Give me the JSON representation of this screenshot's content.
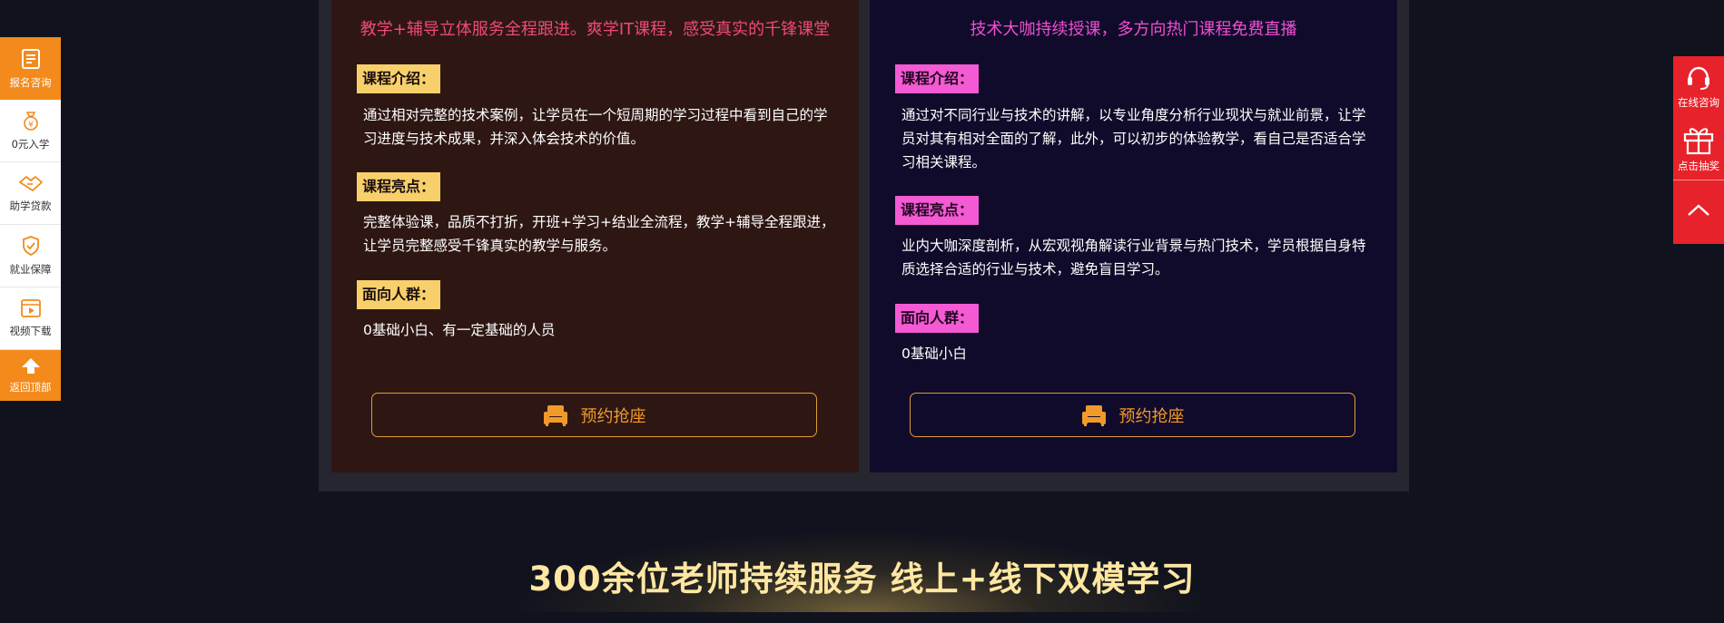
{
  "left_card": {
    "subtitle": "教学+辅导立体服务全程跟进。爽学IT课程，感受真实的千锋课堂",
    "intro_label": "课程介绍：",
    "intro_text": "通过相对完整的技术案例，让学员在一个短周期的学习过程中看到自己的学习进度与技术成果，并深入体会技术的价值。",
    "highlight_label": "课程亮点：",
    "highlight_text": "完整体验课，品质不打折，开班+学习+结业全流程，教学+辅导全程跟进，让学员完整感受千锋真实的教学与服务。",
    "audience_label": "面向人群：",
    "audience_text": "0基础小白、有一定基础的人员",
    "button_label": "预约抢座"
  },
  "right_card": {
    "subtitle": "技术大咖持续授课，多方向热门课程免费直播",
    "intro_label": "课程介绍：",
    "intro_text": "通过对不同行业与技术的讲解，以专业角度分析行业现状与就业前景，让学员对其有相对全面的了解，此外，可以初步的体验教学，看自己是否适合学习相关课程。",
    "highlight_label": "课程亮点：",
    "highlight_text": "业内大咖深度剖析，从宏观视角解读行业背景与热门技术，学员根据自身特质选择合适的行业与技术，避免盲目学习。",
    "audience_label": "面向人群：",
    "audience_text": "0基础小白",
    "button_label": "预约抢座"
  },
  "headline": "300余位老师持续服务 线上+线下双模学习",
  "left_bar": {
    "items": [
      {
        "label": "报名咨询",
        "icon": "register-icon"
      },
      {
        "label": "0元入学",
        "icon": "money-bag-icon"
      },
      {
        "label": "助学贷款",
        "icon": "handshake-icon"
      },
      {
        "label": "就业保障",
        "icon": "shield-check-icon"
      },
      {
        "label": "视频下载",
        "icon": "video-icon"
      },
      {
        "label": "返回顶部",
        "icon": "arrow-up-icon"
      }
    ]
  },
  "right_bar": {
    "items": [
      {
        "label": "在线咨询",
        "icon": "headset-icon"
      },
      {
        "label": "点击抽奖",
        "icon": "gift-icon"
      }
    ],
    "top_icon": "chevron-up-icon"
  },
  "colors": {
    "left_accent": "#ef4a78",
    "right_accent": "#ef4fd1",
    "left_tag": "#f7d06c",
    "right_tag": "#f35ad3",
    "button_orange": "#f19a2a",
    "side_orange": "#f38a1b",
    "side_red": "#e8222a",
    "headline": "#ffe7a1"
  }
}
